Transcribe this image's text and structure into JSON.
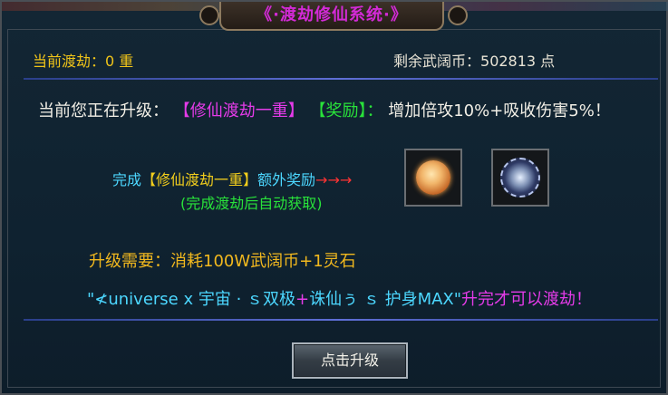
{
  "window": {
    "title": "《·渡劫修仙系统·》"
  },
  "header": {
    "current_label": "当前渡劫：",
    "current_value": "0 重",
    "coins_label": "剩余武阔币：",
    "coins_value": "502813 点"
  },
  "upgrade": {
    "prefix": "当前您正在升级：",
    "target": "【修仙渡劫一重】",
    "reward_tag": "【奖励】",
    "colon": "：",
    "reward_text": "增加倍攻10%+吸收伤害5%！"
  },
  "completion": {
    "prefix": "完成",
    "stage": "【修仙渡劫一重】",
    "suffix": "额外奖励",
    "arrows": "→→→",
    "note": "(完成渡劫后自动获取)"
  },
  "reward_items": [
    {
      "icon": "orb-icon"
    },
    {
      "icon": "wheel-icon"
    }
  ],
  "requirement": {
    "text": "升级需要：消耗100W武阔币+1灵石"
  },
  "max_requirement": {
    "quote_open": "\"",
    "item1": "≮universe x 宇宙 · ｓ双极",
    "plus": "+",
    "item2": "诛仙ぅ ｓ 护身MAX",
    "quote_close": "\"",
    "suffix": "升完才可以渡劫！"
  },
  "actions": {
    "upgrade_button": "点击升级"
  },
  "colors": {
    "title": "#d22ad6",
    "magenta": "#e43be8",
    "green": "#29e23a",
    "yellow": "#f4cf1c",
    "cyan": "#4cd7ff",
    "orange": "#f1b81e"
  }
}
